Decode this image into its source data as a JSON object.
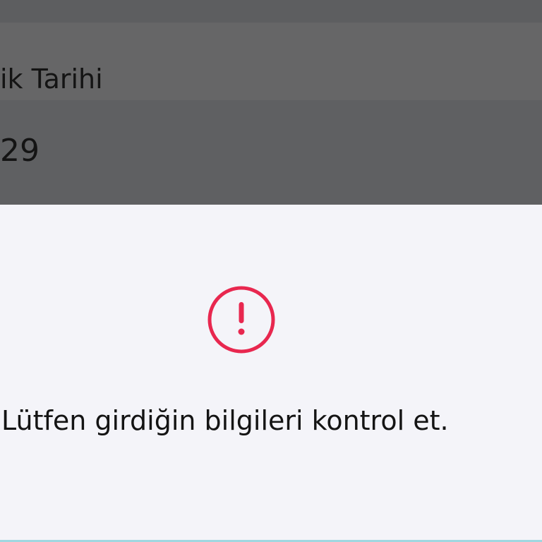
{
  "background_form": {
    "field_label": "ik Tarihi",
    "field_value": "29"
  },
  "sheet": {
    "icon": "exclamation-circle-icon",
    "message": "Lütfen girdiğin bilgileri kontrol et."
  },
  "colors": {
    "alert_accent": "#e8274f",
    "sheet_background": "#f4f4f9",
    "backdrop_overlay": "#606163",
    "text": "#141414"
  }
}
